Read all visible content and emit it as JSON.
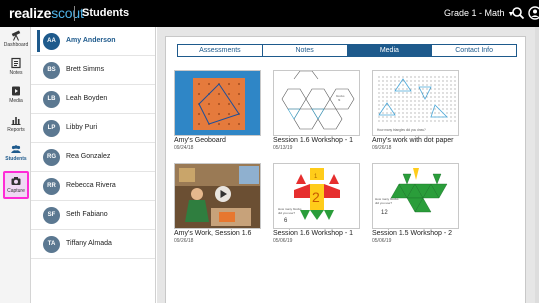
{
  "app": {
    "logo_realize": "realize",
    "logo_scout": "scout",
    "title": "Students",
    "grade_selector": "Grade 1 - Math"
  },
  "rail": [
    {
      "label": "Dashboard",
      "icon": "telescope-icon"
    },
    {
      "label": "Notes",
      "icon": "note-icon"
    },
    {
      "label": "Media",
      "icon": "media-icon"
    },
    {
      "label": "Reports",
      "icon": "bar-chart-icon"
    },
    {
      "label": "Students",
      "icon": "people-icon"
    },
    {
      "label": "Capture",
      "icon": "camera-icon"
    }
  ],
  "students": [
    {
      "initials": "AA",
      "name": "Amy Anderson"
    },
    {
      "initials": "BS",
      "name": "Brett Simms"
    },
    {
      "initials": "LB",
      "name": "Leah Boyden"
    },
    {
      "initials": "LP",
      "name": "Libby Puri"
    },
    {
      "initials": "RG",
      "name": "Rea Gonzalez"
    },
    {
      "initials": "RR",
      "name": "Rebecca Rivera"
    },
    {
      "initials": "SF",
      "name": "Seth Fabiano"
    },
    {
      "initials": "TA",
      "name": "Tiffany Almada"
    }
  ],
  "tabs": [
    {
      "label": "Assessments"
    },
    {
      "label": "Notes"
    },
    {
      "label": "Media"
    },
    {
      "label": "Contact Info"
    }
  ],
  "media": [
    {
      "title": "Amy's Geoboard",
      "date": "09/24/18",
      "kind": "geoboard"
    },
    {
      "title": "Session 1.6 Workshop - 1",
      "date": "05/13/19",
      "kind": "hexagon-outline"
    },
    {
      "title": "Amy's work with dot paper",
      "date": "09/26/18",
      "kind": "dot-paper"
    },
    {
      "title": "Amy's Work, Session 1.6",
      "date": "09/26/18",
      "kind": "video"
    },
    {
      "title": "Session 1.6 Workshop - 1",
      "date": "05/06/19",
      "kind": "pattern-blocks"
    },
    {
      "title": "Session 1.5 Workshop - 2",
      "date": "05/06/19",
      "kind": "triangle-blocks"
    }
  ],
  "colors": {
    "accent": "#1e5a8c",
    "capture_highlight": "#ff2bd6",
    "logo_scout": "#4fb3e8"
  }
}
